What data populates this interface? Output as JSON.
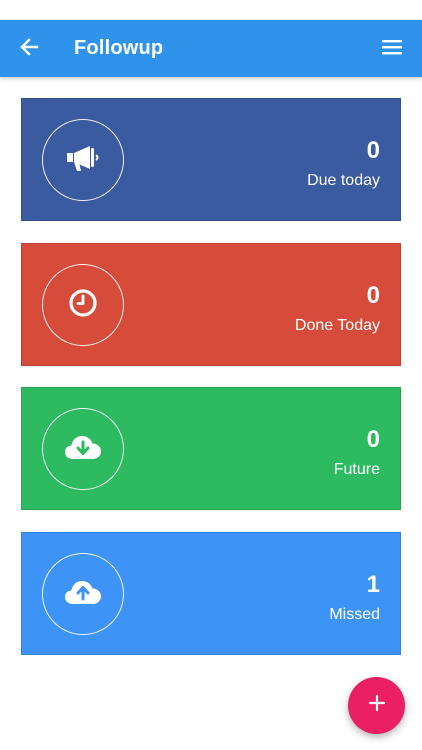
{
  "appbar": {
    "title": "Followup",
    "back_icon": "arrow-left-icon",
    "menu_icon": "hamburger-menu-icon",
    "color": "#2f93eb"
  },
  "cards": [
    {
      "count": "0",
      "label": "Due today",
      "icon": "megaphone-icon",
      "color": "#3a5ba0"
    },
    {
      "count": "0",
      "label": "Done Today",
      "icon": "clock-icon",
      "color": "#d64b3a"
    },
    {
      "count": "0",
      "label": "Future",
      "icon": "cloud-download-icon",
      "color": "#2dba60"
    },
    {
      "count": "1",
      "label": "Missed",
      "icon": "cloud-upload-icon",
      "color": "#3d94f6"
    }
  ],
  "fab": {
    "icon": "plus-icon",
    "color": "#ea1f64"
  }
}
